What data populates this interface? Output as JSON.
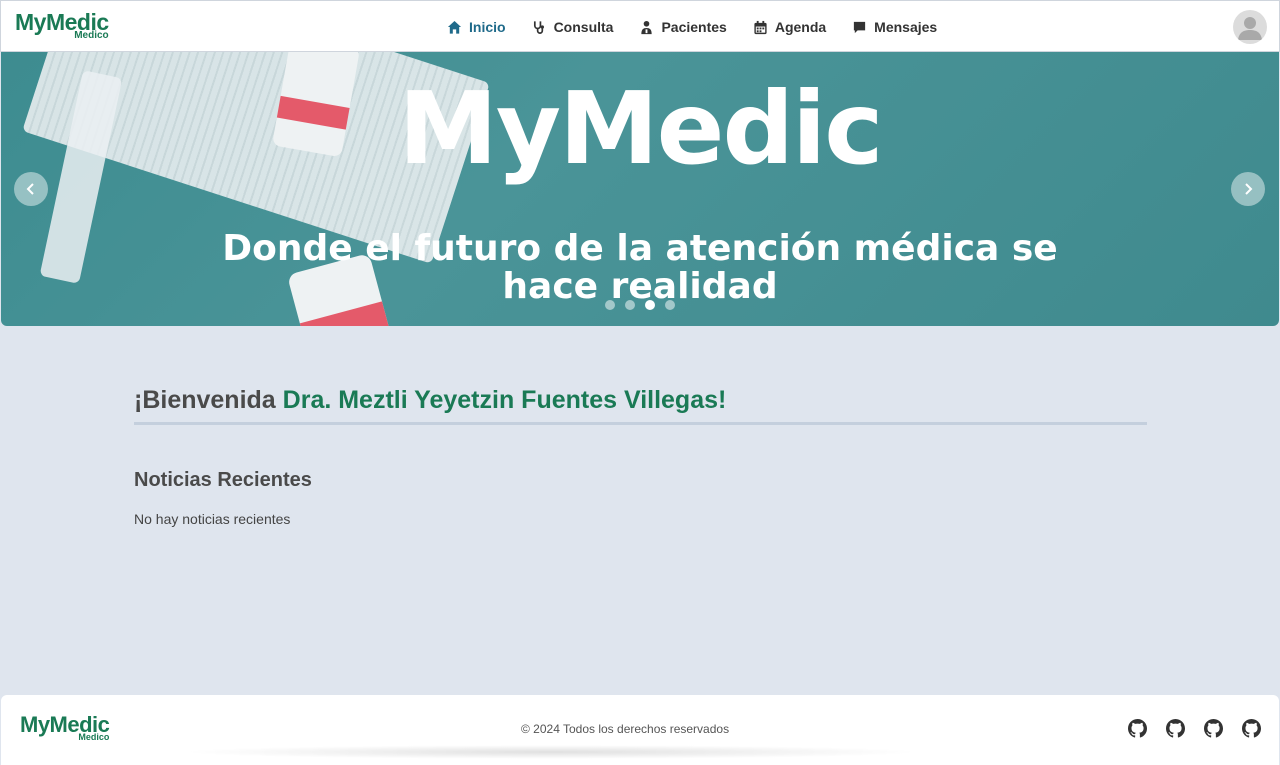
{
  "brand": {
    "name": "MyMedic",
    "sub": "Medico"
  },
  "nav": {
    "items": [
      {
        "label": "Inicio",
        "icon": "home-icon",
        "active": true
      },
      {
        "label": "Consulta",
        "icon": "stethoscope-icon",
        "active": false
      },
      {
        "label": "Pacientes",
        "icon": "patient-icon",
        "active": false
      },
      {
        "label": "Agenda",
        "icon": "calendar-icon",
        "active": false
      },
      {
        "label": "Mensajes",
        "icon": "message-icon",
        "active": false
      }
    ],
    "active_color": "#1f6a8a"
  },
  "carousel": {
    "title": "MyMedic",
    "subtitle_line1": "Donde el futuro de la atención médica se",
    "subtitle_line2": "hace realidad",
    "slide_count": 4,
    "active_slide": 3
  },
  "main": {
    "welcome_prefix": "¡Bienvenida ",
    "welcome_name": "Dra. Meztli Yeyetzin Fuentes Villegas!",
    "news_title": "Noticias Recientes",
    "news_empty": "No hay noticias recientes"
  },
  "footer": {
    "copyright": "© 2024 Todos los derechos reservados",
    "socials": [
      "github-icon",
      "github-icon",
      "github-icon",
      "github-icon"
    ]
  },
  "colors": {
    "brand_green": "#1a7a55",
    "cross_green": "#3cb56a",
    "background": "#dfe5ee"
  }
}
